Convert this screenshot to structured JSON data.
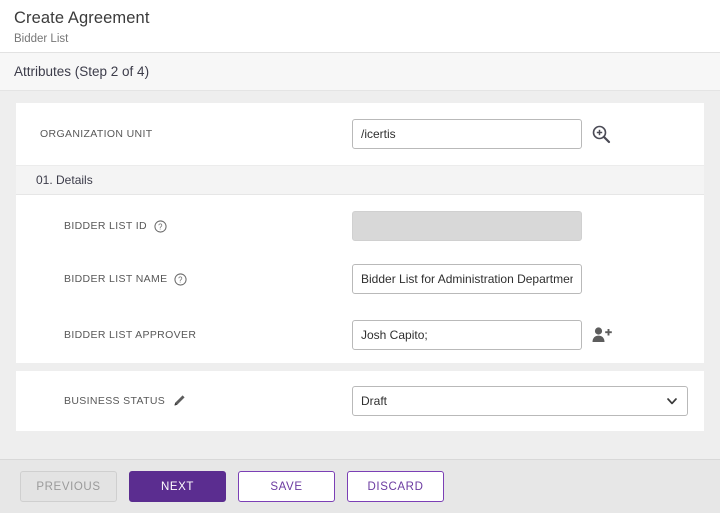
{
  "header": {
    "title": "Create Agreement",
    "subtitle": "Bidder List"
  },
  "step": {
    "title": "Attributes (Step 2 of 4)"
  },
  "org_unit": {
    "label": "ORGANIZATION UNIT",
    "value": "/icertis",
    "search_icon": "magnifier-plus-icon"
  },
  "details_section": {
    "title": "01. Details",
    "fields": [
      {
        "label": "BIDDER LIST ID",
        "value": "",
        "help_icon": "help-circle-icon",
        "disabled": true
      },
      {
        "label": "BIDDER LIST NAME",
        "value": "Bidder List for Administration Department",
        "help_icon": "help-circle-icon",
        "disabled": false
      },
      {
        "label": "BIDDER LIST APPROVER",
        "value": "Josh Capito;",
        "action_icon": "person-add-icon",
        "disabled": false
      }
    ]
  },
  "status_section": {
    "label": "BUSINESS STATUS",
    "edit_icon": "pencil-icon",
    "value": "Draft",
    "chevron_icon": "chevron-down-icon"
  },
  "footer": {
    "previous_label": "PREVIOUS",
    "next_label": "NEXT",
    "save_label": "SAVE",
    "discard_label": "DISCARD"
  },
  "colors": {
    "accent": "#5b2d90",
    "outline": "#7b3fb5",
    "page_bg": "#eeeeee",
    "footer_bg": "#e7e7e7"
  }
}
